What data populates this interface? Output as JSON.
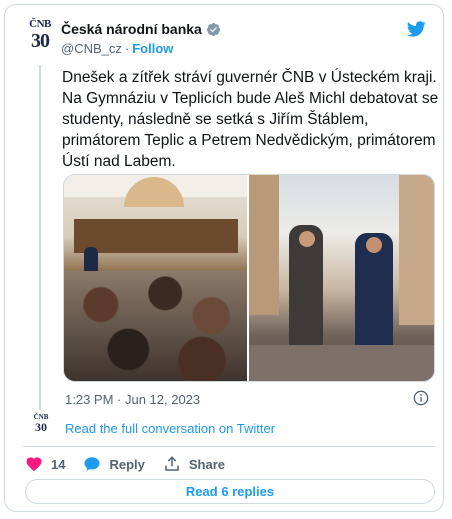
{
  "account": {
    "avatar_top": "ČNB",
    "avatar_num": "30",
    "name": "Česká národní banka",
    "handle": "@CNB_cz",
    "separator": "·",
    "follow_label": "Follow"
  },
  "tweet": {
    "text": "Dnešek a zítřek stráví guvernér ČNB v Ústeckém kraji. Na Gymnáziu v Teplicích bude Aleš Michl debatovat se studenty, následně se setká s Jiřím Štáblem, primátorem Teplic a Petrem Nedvědickým, primátorem Ústí nad Labem.",
    "timestamp": "1:23 PM · Jun 12, 2023",
    "read_conversation": "Read the full conversation on Twitter"
  },
  "actions": {
    "likes_count": "14",
    "reply_label": "Reply",
    "share_label": "Share"
  },
  "read_replies_label": "Read 6 replies",
  "colors": {
    "accent": "#1d9bf0",
    "like": "#f91880",
    "muted": "#536471",
    "border": "#cfd9de"
  },
  "icons": [
    "verified-badge-icon",
    "twitter-bird-icon",
    "info-icon",
    "heart-icon",
    "reply-bubble-icon",
    "share-icon"
  ]
}
